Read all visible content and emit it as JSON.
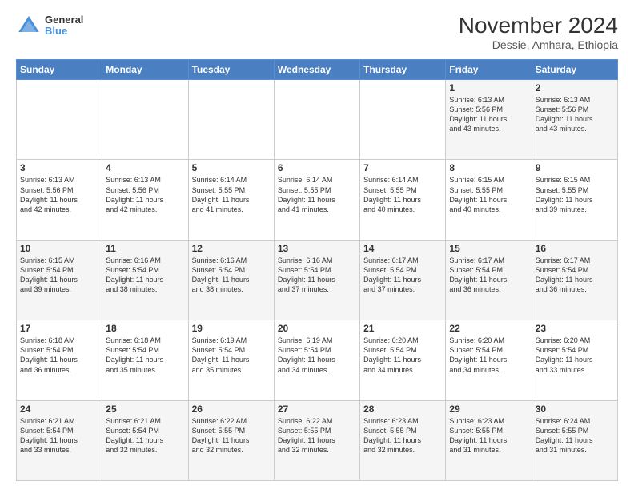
{
  "logo": {
    "line1": "General",
    "line2": "Blue"
  },
  "title": "November 2024",
  "subtitle": "Dessie, Amhara, Ethiopia",
  "days_of_week": [
    "Sunday",
    "Monday",
    "Tuesday",
    "Wednesday",
    "Thursday",
    "Friday",
    "Saturday"
  ],
  "weeks": [
    [
      {
        "day": "",
        "info": ""
      },
      {
        "day": "",
        "info": ""
      },
      {
        "day": "",
        "info": ""
      },
      {
        "day": "",
        "info": ""
      },
      {
        "day": "",
        "info": ""
      },
      {
        "day": "1",
        "info": "Sunrise: 6:13 AM\nSunset: 5:56 PM\nDaylight: 11 hours\nand 43 minutes."
      },
      {
        "day": "2",
        "info": "Sunrise: 6:13 AM\nSunset: 5:56 PM\nDaylight: 11 hours\nand 43 minutes."
      }
    ],
    [
      {
        "day": "3",
        "info": "Sunrise: 6:13 AM\nSunset: 5:56 PM\nDaylight: 11 hours\nand 42 minutes."
      },
      {
        "day": "4",
        "info": "Sunrise: 6:13 AM\nSunset: 5:56 PM\nDaylight: 11 hours\nand 42 minutes."
      },
      {
        "day": "5",
        "info": "Sunrise: 6:14 AM\nSunset: 5:55 PM\nDaylight: 11 hours\nand 41 minutes."
      },
      {
        "day": "6",
        "info": "Sunrise: 6:14 AM\nSunset: 5:55 PM\nDaylight: 11 hours\nand 41 minutes."
      },
      {
        "day": "7",
        "info": "Sunrise: 6:14 AM\nSunset: 5:55 PM\nDaylight: 11 hours\nand 40 minutes."
      },
      {
        "day": "8",
        "info": "Sunrise: 6:15 AM\nSunset: 5:55 PM\nDaylight: 11 hours\nand 40 minutes."
      },
      {
        "day": "9",
        "info": "Sunrise: 6:15 AM\nSunset: 5:55 PM\nDaylight: 11 hours\nand 39 minutes."
      }
    ],
    [
      {
        "day": "10",
        "info": "Sunrise: 6:15 AM\nSunset: 5:54 PM\nDaylight: 11 hours\nand 39 minutes."
      },
      {
        "day": "11",
        "info": "Sunrise: 6:16 AM\nSunset: 5:54 PM\nDaylight: 11 hours\nand 38 minutes."
      },
      {
        "day": "12",
        "info": "Sunrise: 6:16 AM\nSunset: 5:54 PM\nDaylight: 11 hours\nand 38 minutes."
      },
      {
        "day": "13",
        "info": "Sunrise: 6:16 AM\nSunset: 5:54 PM\nDaylight: 11 hours\nand 37 minutes."
      },
      {
        "day": "14",
        "info": "Sunrise: 6:17 AM\nSunset: 5:54 PM\nDaylight: 11 hours\nand 37 minutes."
      },
      {
        "day": "15",
        "info": "Sunrise: 6:17 AM\nSunset: 5:54 PM\nDaylight: 11 hours\nand 36 minutes."
      },
      {
        "day": "16",
        "info": "Sunrise: 6:17 AM\nSunset: 5:54 PM\nDaylight: 11 hours\nand 36 minutes."
      }
    ],
    [
      {
        "day": "17",
        "info": "Sunrise: 6:18 AM\nSunset: 5:54 PM\nDaylight: 11 hours\nand 36 minutes."
      },
      {
        "day": "18",
        "info": "Sunrise: 6:18 AM\nSunset: 5:54 PM\nDaylight: 11 hours\nand 35 minutes."
      },
      {
        "day": "19",
        "info": "Sunrise: 6:19 AM\nSunset: 5:54 PM\nDaylight: 11 hours\nand 35 minutes."
      },
      {
        "day": "20",
        "info": "Sunrise: 6:19 AM\nSunset: 5:54 PM\nDaylight: 11 hours\nand 34 minutes."
      },
      {
        "day": "21",
        "info": "Sunrise: 6:20 AM\nSunset: 5:54 PM\nDaylight: 11 hours\nand 34 minutes."
      },
      {
        "day": "22",
        "info": "Sunrise: 6:20 AM\nSunset: 5:54 PM\nDaylight: 11 hours\nand 34 minutes."
      },
      {
        "day": "23",
        "info": "Sunrise: 6:20 AM\nSunset: 5:54 PM\nDaylight: 11 hours\nand 33 minutes."
      }
    ],
    [
      {
        "day": "24",
        "info": "Sunrise: 6:21 AM\nSunset: 5:54 PM\nDaylight: 11 hours\nand 33 minutes."
      },
      {
        "day": "25",
        "info": "Sunrise: 6:21 AM\nSunset: 5:54 PM\nDaylight: 11 hours\nand 32 minutes."
      },
      {
        "day": "26",
        "info": "Sunrise: 6:22 AM\nSunset: 5:55 PM\nDaylight: 11 hours\nand 32 minutes."
      },
      {
        "day": "27",
        "info": "Sunrise: 6:22 AM\nSunset: 5:55 PM\nDaylight: 11 hours\nand 32 minutes."
      },
      {
        "day": "28",
        "info": "Sunrise: 6:23 AM\nSunset: 5:55 PM\nDaylight: 11 hours\nand 32 minutes."
      },
      {
        "day": "29",
        "info": "Sunrise: 6:23 AM\nSunset: 5:55 PM\nDaylight: 11 hours\nand 31 minutes."
      },
      {
        "day": "30",
        "info": "Sunrise: 6:24 AM\nSunset: 5:55 PM\nDaylight: 11 hours\nand 31 minutes."
      }
    ]
  ]
}
